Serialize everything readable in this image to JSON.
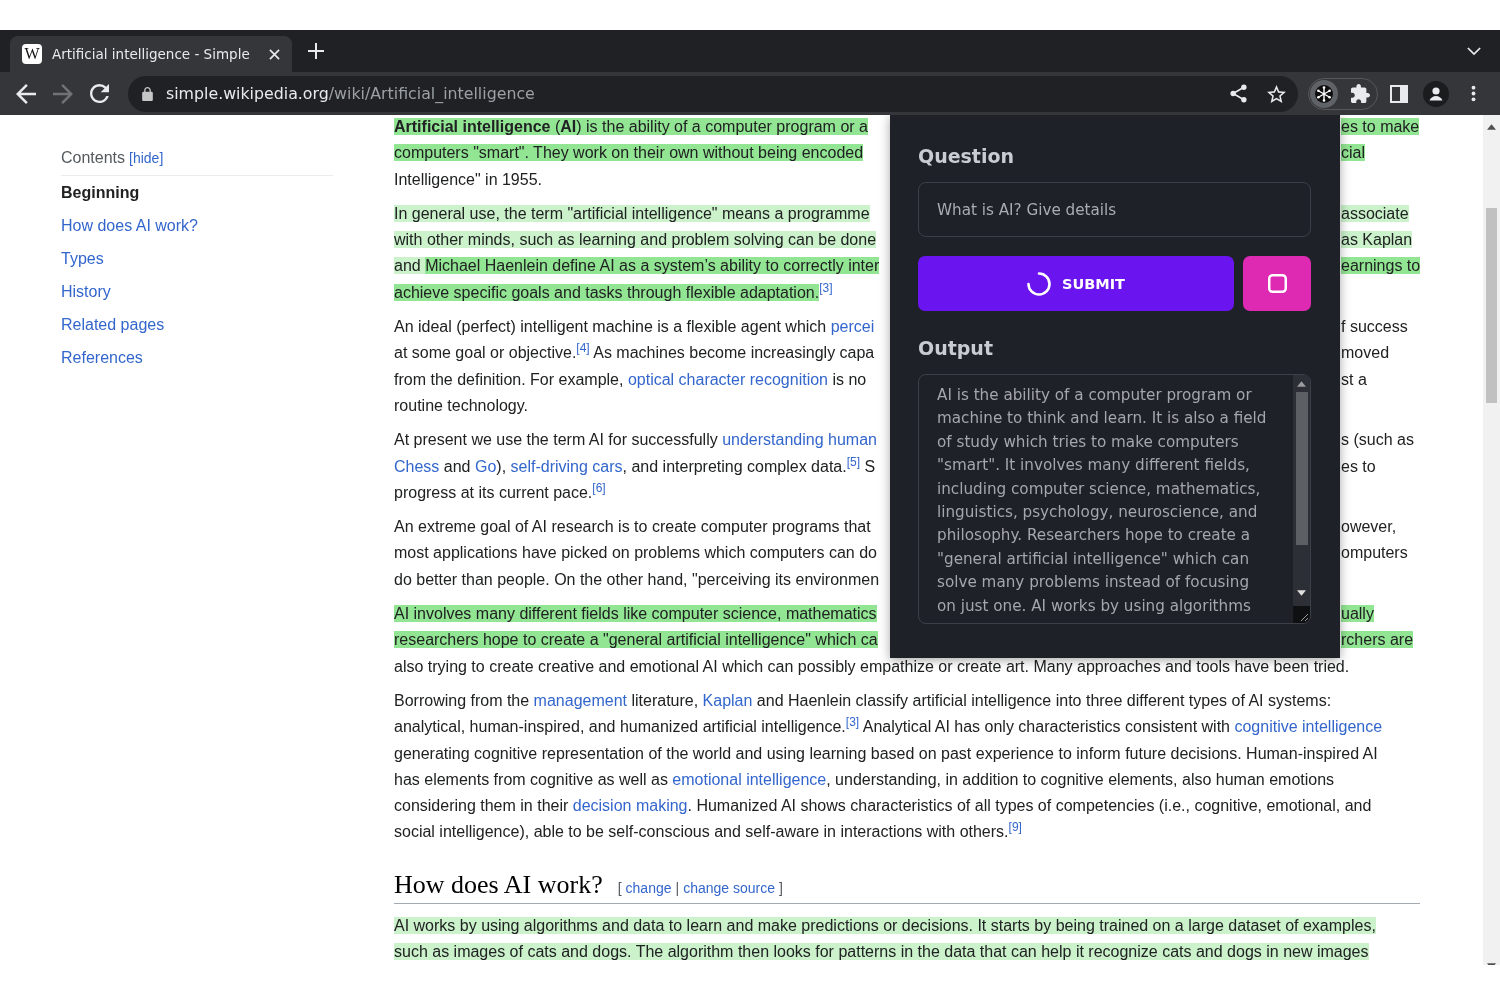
{
  "browser": {
    "tab": {
      "favicon": "W",
      "title": "Artificial intelligence - Simple",
      "selected": true
    },
    "navigation": {
      "back": {
        "disabled": false
      },
      "forward": {
        "disabled": true
      }
    },
    "address": {
      "host": "simple.wikipedia.org",
      "path": "/wiki/Artificial_intelligence"
    },
    "extension": {
      "active": true
    }
  },
  "sidebar": {
    "title": "Contents",
    "toggle": "[hide]",
    "items": [
      {
        "label": "Beginning",
        "selected": true
      },
      {
        "label": "How does AI work?",
        "selected": false
      },
      {
        "label": "Types",
        "selected": false
      },
      {
        "label": "History",
        "selected": false
      },
      {
        "label": "Related pages",
        "selected": false
      },
      {
        "label": "References",
        "selected": false
      }
    ]
  },
  "article": {
    "blocks": [
      {
        "kind": "covered",
        "lines": [
          {
            "left": [
              {
                "kind": "text",
                "text": "**Artificial intelligence** (**AI**) is the ability of a computer program or a",
                "color": "#92e592"
              }
            ],
            "right": [
              {
                "kind": "text",
                "text": "es to make",
                "color": "#92e592"
              }
            ]
          },
          {
            "left": [
              {
                "kind": "text",
                "text": "computers \"smart\". They work on their own without being encoded",
                "color": "#92e592"
              }
            ],
            "right": [
              {
                "kind": "text",
                "text": "cial",
                "color": "#92e592"
              }
            ]
          },
          {
            "left": [
              {
                "kind": "text",
                "text": "Intelligence\" in 1955."
              }
            ]
          }
        ]
      },
      {
        "kind": "covered",
        "lines": [
          {
            "left": [
              {
                "kind": "text",
                "text": "In general use, the term \"artificial intelligence\" means a programme",
                "color": "#cbf2cb"
              }
            ],
            "right": [
              {
                "kind": "text",
                "text": "associate",
                "color": "#cbf2cb"
              }
            ]
          },
          {
            "left": [
              {
                "kind": "text",
                "text": "with other minds, such as learning and problem solving can be done",
                "color": "#cbf2cb"
              }
            ],
            "right": [
              {
                "kind": "text",
                "text": "as Kaplan",
                "color": "#cbf2cb"
              }
            ]
          },
          {
            "left": [
              {
                "kind": "text",
                "text": "and ",
                "color": "#cbf2cb"
              },
              {
                "kind": "text",
                "text": "Michael Haenlein define AI as a system’s ability to correctly inter",
                "color": "#92e592"
              }
            ],
            "right": [
              {
                "kind": "text",
                "text": "earnings to",
                "color": "#92e592"
              }
            ]
          },
          {
            "left": [
              {
                "kind": "text",
                "text": "achieve specific goals and tasks through flexible adaptation.",
                "color": "#92e592"
              },
              {
                "kind": "ref",
                "text": "[3]"
              }
            ]
          }
        ]
      },
      {
        "kind": "covered",
        "lines": [
          {
            "left": [
              {
                "kind": "text",
                "text": "An ideal (perfect) intelligent machine is a flexible agent which "
              },
              {
                "kind": "link",
                "text": "percei"
              }
            ],
            "right": [
              {
                "kind": "text",
                "text": "f success"
              }
            ]
          },
          {
            "left": [
              {
                "kind": "text",
                "text": "at some goal or objective."
              },
              {
                "kind": "ref",
                "text": "[4]"
              },
              {
                "kind": "text",
                "text": " As machines become increasingly capa"
              }
            ],
            "right": [
              {
                "kind": "text",
                "text": "moved"
              }
            ]
          },
          {
            "left": [
              {
                "kind": "text",
                "text": "from the definition. For example, "
              },
              {
                "kind": "link",
                "text": "optical character recognition"
              },
              {
                "kind": "text",
                "text": " is no"
              }
            ],
            "right": [
              {
                "kind": "text",
                "text": "st a"
              }
            ]
          },
          {
            "left": [
              {
                "kind": "text",
                "text": "routine technology."
              }
            ]
          }
        ]
      },
      {
        "kind": "covered",
        "lines": [
          {
            "left": [
              {
                "kind": "text",
                "text": "At present we use the term AI for successfully "
              },
              {
                "kind": "link",
                "text": "understanding human"
              }
            ],
            "right": [
              {
                "kind": "text",
                "text": "s (such as"
              }
            ]
          },
          {
            "left": [
              {
                "kind": "link",
                "text": "Chess"
              },
              {
                "kind": "text",
                "text": " and "
              },
              {
                "kind": "link",
                "text": "Go"
              },
              {
                "kind": "text",
                "text": "), "
              },
              {
                "kind": "link",
                "text": "self-driving cars"
              },
              {
                "kind": "text",
                "text": ", and interpreting complex data."
              },
              {
                "kind": "ref",
                "text": "[5]"
              },
              {
                "kind": "text",
                "text": " S"
              }
            ],
            "right": [
              {
                "kind": "text",
                "text": "es to"
              }
            ]
          },
          {
            "left": [
              {
                "kind": "text",
                "text": "progress at its current pace."
              },
              {
                "kind": "ref",
                "text": "[6]"
              }
            ]
          }
        ]
      },
      {
        "kind": "covered",
        "lines": [
          {
            "left": [
              {
                "kind": "text",
                "text": "An extreme goal of AI research is to create computer programs that"
              }
            ],
            "right": [
              {
                "kind": "text",
                "text": "owever,"
              }
            ]
          },
          {
            "left": [
              {
                "kind": "text",
                "text": "most applications have picked on problems which computers can do"
              }
            ],
            "right": [
              {
                "kind": "text",
                "text": "omputers"
              }
            ]
          },
          {
            "left": [
              {
                "kind": "text",
                "text": "do better than people. On the other hand, \"perceiving its environmen"
              }
            ]
          }
        ]
      },
      {
        "kind": "covered",
        "lines": [
          {
            "left": [
              {
                "kind": "text",
                "text": "AI involves many different fields like computer science, mathematics",
                "color": "#92e592"
              }
            ],
            "right": [
              {
                "kind": "text",
                "text": "ually",
                "color": "#92e592"
              }
            ]
          },
          {
            "left": [
              {
                "kind": "text",
                "text": "researchers hope to create a \"general artificial intelligence\" which ca",
                "color": "#92e592"
              }
            ],
            "right": [
              {
                "kind": "text",
                "text": "rchers are",
                "color": "#92e592"
              }
            ]
          },
          {
            "left": [
              {
                "kind": "text",
                "text": "also trying to create creative and emotional AI which can possibly empathize or create art. Many approaches and tools have been tried."
              }
            ]
          }
        ]
      },
      {
        "kind": "full",
        "lines": [
          {
            "segments": [
              {
                "kind": "text",
                "text": "Borrowing from the "
              },
              {
                "kind": "link",
                "text": "management"
              },
              {
                "kind": "text",
                "text": " literature, "
              },
              {
                "kind": "link",
                "text": "Kaplan"
              },
              {
                "kind": "text",
                "text": " and Haenlein classify artificial intelligence into three different types of AI systems:"
              }
            ]
          },
          {
            "segments": [
              {
                "kind": "text",
                "text": "analytical, human-inspired, and humanized artificial intelligence."
              },
              {
                "kind": "ref",
                "text": "[3]"
              },
              {
                "kind": "text",
                "text": " Analytical AI has only characteristics consistent with "
              },
              {
                "kind": "link",
                "text": "cognitive intelligence"
              }
            ]
          },
          {
            "segments": [
              {
                "kind": "text",
                "text": "generating cognitive representation of the world and using learning based on past experience to inform future decisions. Human-inspired AI"
              }
            ]
          },
          {
            "segments": [
              {
                "kind": "text",
                "text": "has elements from cognitive as well as "
              },
              {
                "kind": "link",
                "text": "emotional intelligence"
              },
              {
                "kind": "text",
                "text": ", understanding, in addition to cognitive elements, also human emotions"
              }
            ]
          },
          {
            "segments": [
              {
                "kind": "text",
                "text": "considering them in their "
              },
              {
                "kind": "link",
                "text": "decision making"
              },
              {
                "kind": "text",
                "text": ". Humanized AI shows characteristics of all types of competencies (i.e., cognitive, emotional, and"
              }
            ]
          },
          {
            "segments": [
              {
                "kind": "text",
                "text": "social intelligence), able to be self-conscious and self-aware in interactions with others."
              },
              {
                "kind": "ref",
                "text": "[9]"
              }
            ]
          }
        ]
      },
      {
        "kind": "heading",
        "text": "How does AI work?",
        "edit": {
          "open": "[",
          "links": [
            "change",
            "change source"
          ],
          "separator": "|",
          "close": "]"
        }
      },
      {
        "kind": "full",
        "lines": [
          {
            "segments": [
              {
                "kind": "text",
                "text": "AI works by using algorithms and data to learn and make predictions or decisions. It starts by being trained on a large dataset of examples,",
                "color": "#cbf2cb"
              }
            ]
          },
          {
            "segments": [
              {
                "kind": "text",
                "text": "such as images of cats and dogs. The algorithm then looks for patterns in the data that can help it recognize cats and dogs in new images",
                "color": "#cbf2cb"
              }
            ]
          }
        ]
      }
    ]
  },
  "panel": {
    "question": {
      "label": "Question",
      "value": "What is AI? Give details"
    },
    "submit": {
      "label": "SUBMIT",
      "loading": true
    },
    "output": {
      "label": "Output",
      "value": "AI is the ability of a computer program or machine to think and learn. It is also a field of study which tries to make computers \"smart\". It involves many different fields, including computer science, mathematics, linguistics, psychology, neuroscience, and philosophy. Researchers hope to create a \"general artificial intelligence\" which can solve many problems instead of focusing on just one. AI works by using algorithms"
    }
  }
}
